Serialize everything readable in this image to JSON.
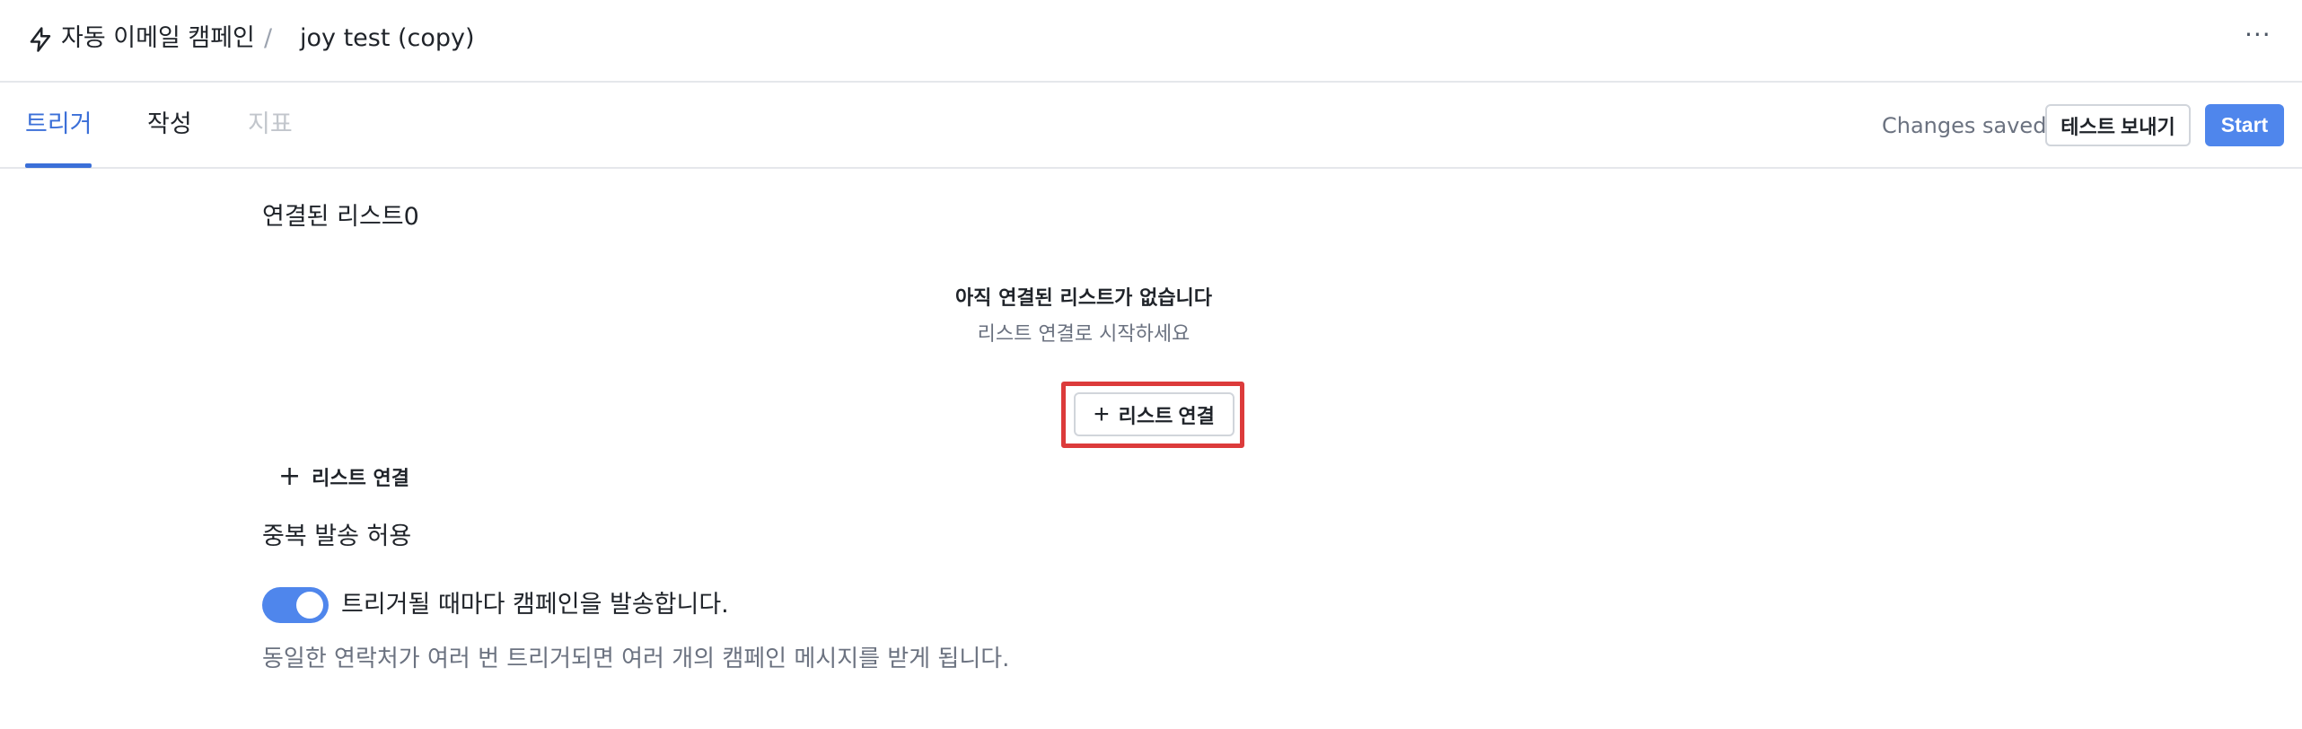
{
  "breadcrumb": {
    "root": "자동 이메일 캠페인",
    "separator": "/",
    "current": "joy test (copy)"
  },
  "header": {
    "more_label": "···"
  },
  "tabs": [
    {
      "label": "트리거",
      "active": true
    },
    {
      "label": "작성",
      "active": false
    },
    {
      "label": "지표",
      "active": false,
      "disabled": true
    }
  ],
  "toolbar": {
    "status": "Changes saved",
    "test_button": "테스트 보내기",
    "start_button": "Start"
  },
  "lists": {
    "title": "연결된 리스트0",
    "empty_title": "아직 연결된 리스트가 없습니다",
    "empty_subtitle": "리스트 연결로 시작하세요",
    "connect_button_center": "리스트 연결",
    "connect_button_left": "리스트 연결"
  },
  "duplicate": {
    "title": "중복 발송 허용",
    "toggle_on": true,
    "toggle_label": "트리거될 때마다 캠페인을 발송합니다.",
    "helper": "동일한 연락처가 여러 번 트리거되면 여러 개의 캠페인 메시지를 받게 됩니다."
  },
  "colors": {
    "accent": "#4f86ec",
    "tab_active": "#3b6fd8",
    "highlight": "#dc3b3b"
  },
  "icons": {
    "breadcrumb": "lightning-icon",
    "plus": "plus-icon",
    "more": "more-horizontal-icon"
  }
}
